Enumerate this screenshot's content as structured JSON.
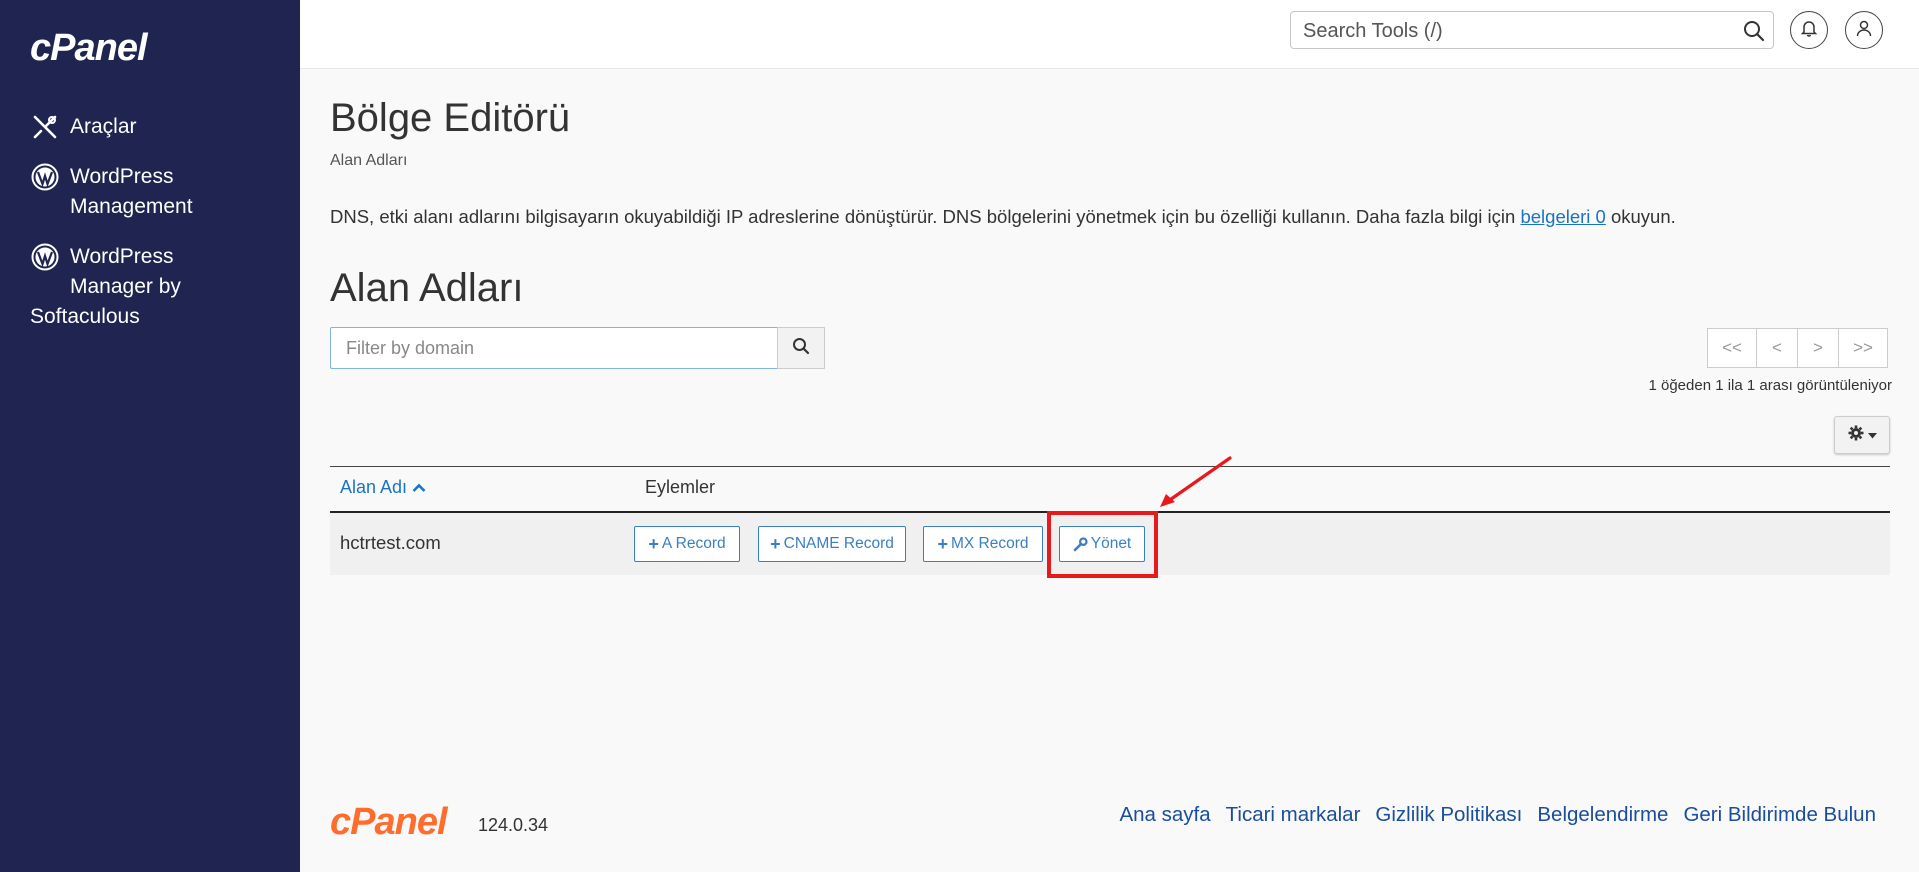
{
  "sidebar": {
    "logo": "cPanel",
    "items": [
      {
        "label": "Araçlar"
      },
      {
        "label_line1": "WordPress",
        "label_line2": "Management"
      },
      {
        "label_line1": "WordPress",
        "label_line2": "Manager by",
        "label_line3": "Softaculous"
      }
    ]
  },
  "header": {
    "search_placeholder": "Search Tools (/)"
  },
  "page": {
    "title": "Bölge Editörü",
    "breadcrumb": "Alan Adları",
    "description_before": "DNS, etki alanı adlarını bilgisayarın okuyabildiği IP adreslerine dönüştürür. DNS bölgelerini yönetmek için bu özelliği kullanın. Daha fazla bilgi için ",
    "description_link": "belgeleri 0",
    "description_after": " okuyun.",
    "section_title": "Alan Adları",
    "filter_placeholder": "Filter by domain",
    "pager": [
      "<<",
      "<",
      ">",
      ">>"
    ],
    "range_text": "1 öğeden 1 ila 1 arası görüntüleniyor"
  },
  "table": {
    "headers": {
      "domain": "Alan Adı",
      "actions": "Eylemler"
    },
    "rows": [
      {
        "domain": "hctrtest.com",
        "actions": [
          "A Record",
          "CNAME Record",
          "MX Record",
          "Yönet"
        ]
      }
    ]
  },
  "footer": {
    "logo": "cPanel",
    "version": "124.0.34",
    "links": [
      "Ana sayfa",
      "Ticari markalar",
      "Gizlilik Politikası",
      "Belgelendirme",
      "Geri Bildirimde Bulun"
    ]
  },
  "colors": {
    "sidebar_bg": "#1f2550",
    "link": "#1a73c9",
    "action_border": "#3a7fc1",
    "highlight": "#e8191c",
    "footer_logo": "#ff6c2c"
  }
}
